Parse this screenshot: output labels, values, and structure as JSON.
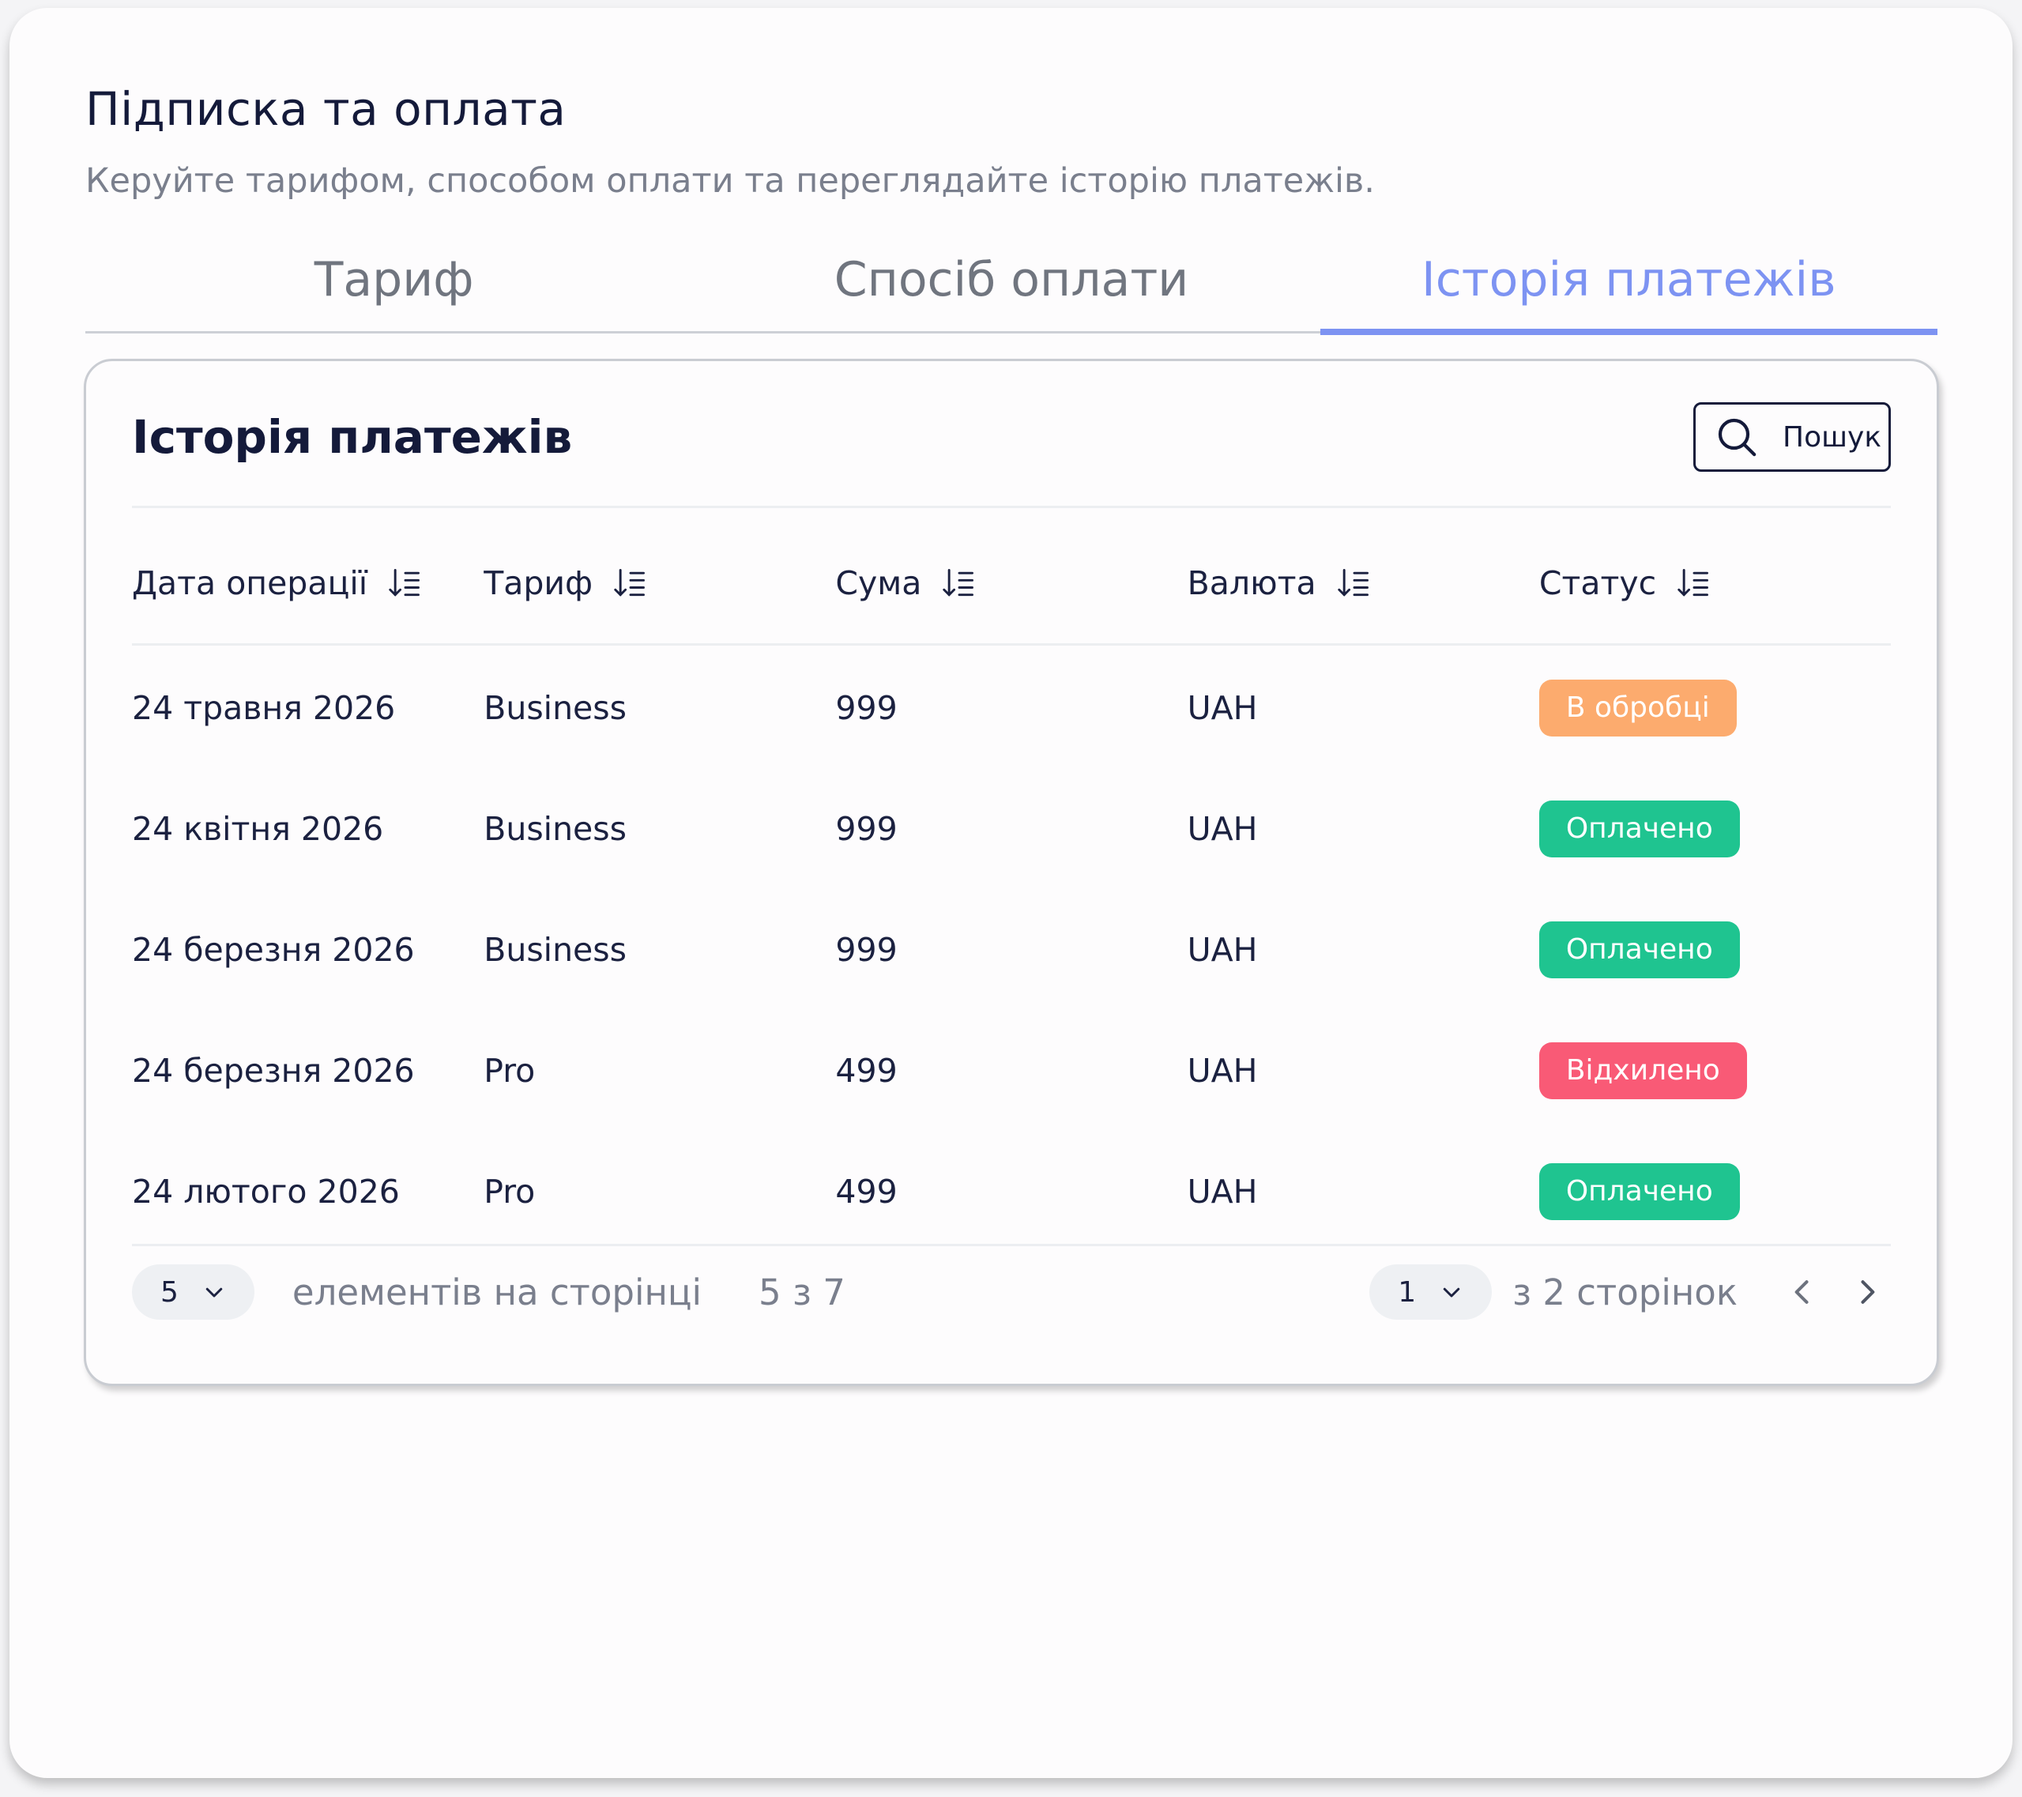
{
  "header": {
    "title": "Підписка та оплата",
    "subtitle": "Керуйте тарифом, способом оплати та переглядайте історію платежів."
  },
  "tabs": [
    {
      "label": "Тариф",
      "active": false
    },
    {
      "label": "Спосіб оплати",
      "active": false
    },
    {
      "label": "Історія платежів",
      "active": true
    }
  ],
  "history": {
    "title": "Історія платежів",
    "search_label": "Пошук",
    "columns": [
      "Дата операції",
      "Тариф",
      "Сума",
      "Валюта",
      "Статус"
    ],
    "rows": [
      {
        "date": "24 травня 2026",
        "plan": "Business",
        "amount": "999",
        "currency": "UAH",
        "status": "В обробці",
        "status_color": "#fcab6e"
      },
      {
        "date": "24 квітня 2026",
        "plan": "Business",
        "amount": "999",
        "currency": "UAH",
        "status": "Оплачено",
        "status_color": "#1fc490"
      },
      {
        "date": "24 березня 2026",
        "plan": "Business",
        "amount": "999",
        "currency": "UAH",
        "status": "Оплачено",
        "status_color": "#1fc490"
      },
      {
        "date": "24 березня 2026",
        "plan": "Pro",
        "amount": "499",
        "currency": "UAH",
        "status": "Відхилено",
        "status_color": "#f95a76"
      },
      {
        "date": "24 лютого 2026",
        "plan": "Pro",
        "amount": "499",
        "currency": "UAH",
        "status": "Оплачено",
        "status_color": "#1fc490"
      }
    ]
  },
  "pagination": {
    "per_page_value": "5",
    "per_page_label": "елементів на сторінці",
    "range_text": "5 з 7",
    "page_value": "1",
    "pages_text": "з 2 сторінок"
  },
  "colors": {
    "accent": "#7d93f2",
    "pending": "#fcab6e",
    "paid": "#1fc490",
    "declined": "#f95a76"
  },
  "icons": [
    "search-icon",
    "sort-icon",
    "chevron-down-icon",
    "chevron-left-icon",
    "chevron-right-icon"
  ]
}
